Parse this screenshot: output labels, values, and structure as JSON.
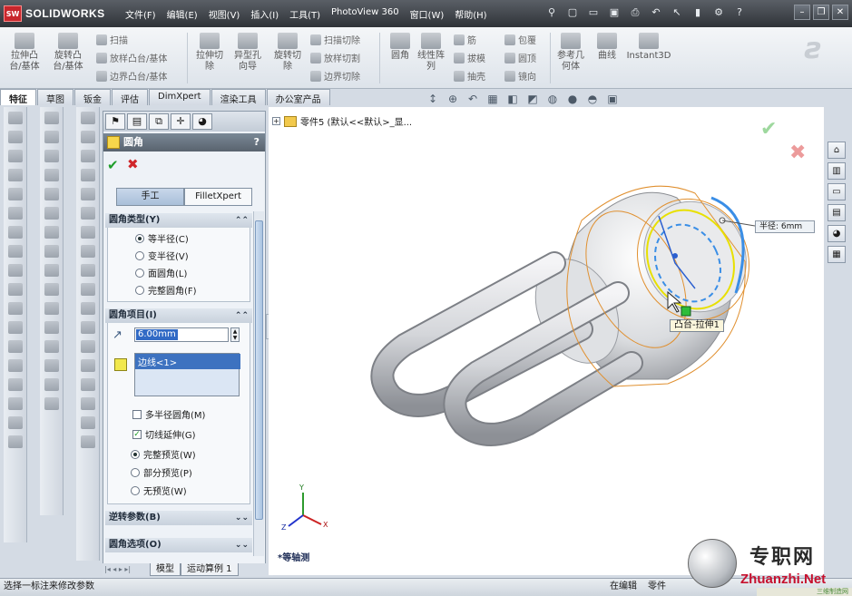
{
  "app": {
    "logo_badge": "SW",
    "name": "SOLIDWORKS"
  },
  "menu": [
    "文件(F)",
    "编辑(E)",
    "视图(V)",
    "插入(I)",
    "工具(T)",
    "PhotoView 360",
    "窗口(W)",
    "帮助(H)"
  ],
  "command_manager": {
    "big": [
      {
        "label": "拉伸凸\n台/基体",
        "icon": "extrude-boss-icon"
      },
      {
        "label": "旋转凸\n台/基体",
        "icon": "revolve-boss-icon"
      },
      {
        "label": "拉伸切\n除",
        "icon": "extrude-cut-icon"
      },
      {
        "label": "异型孔\n向导",
        "icon": "hole-wizard-icon"
      },
      {
        "label": "旋转切\n除",
        "icon": "revolve-cut-icon"
      },
      {
        "label": "圆角",
        "icon": "fillet-icon"
      },
      {
        "label": "线性阵\n列",
        "icon": "linear-pattern-icon"
      },
      {
        "label": "参考几\n何体",
        "icon": "ref-geometry-icon"
      },
      {
        "label": "曲线",
        "icon": "curves-icon"
      },
      {
        "label": "Instant3D",
        "icon": "instant3d-icon"
      }
    ],
    "small": [
      {
        "label": "扫描",
        "icon": "sweep-icon"
      },
      {
        "label": "放样凸台/基体",
        "icon": "loft-icon"
      },
      {
        "label": "边界凸台/基体",
        "icon": "boundary-boss-icon"
      },
      {
        "label": "扫描切除",
        "icon": "swept-cut-icon"
      },
      {
        "label": "放样切割",
        "icon": "lofted-cut-icon"
      },
      {
        "label": "边界切除",
        "icon": "boundary-cut-icon"
      },
      {
        "label": "筋",
        "icon": "rib-icon"
      },
      {
        "label": "拔模",
        "icon": "draft-icon"
      },
      {
        "label": "抽壳",
        "icon": "shell-icon"
      },
      {
        "label": "包覆",
        "icon": "wrap-icon"
      },
      {
        "label": "圆顶",
        "icon": "dome-icon"
      },
      {
        "label": "镜向",
        "icon": "mirror-icon"
      }
    ]
  },
  "tabs": [
    {
      "label": "特征",
      "active": true
    },
    {
      "label": "草图"
    },
    {
      "label": "钣金"
    },
    {
      "label": "评估"
    },
    {
      "label": "DimXpert"
    },
    {
      "label": "渲染工具"
    },
    {
      "label": "办公室产品"
    }
  ],
  "property_manager": {
    "title": "圆角",
    "help": "?",
    "ok": "✔",
    "cancel": "✖",
    "mode_tabs": {
      "manual": "手工",
      "filletxpert": "FilletXpert"
    },
    "fillet_type": {
      "heading": "圆角类型(Y)",
      "options": [
        "等半径(C)",
        "变半径(V)",
        "面圆角(L)",
        "完整圆角(F)"
      ],
      "selected": 0
    },
    "fillet_items": {
      "heading": "圆角项目(I)",
      "radius": "6.00mm",
      "edges": [
        "边线<1>"
      ],
      "multi_radius": "多半径圆角(M)",
      "tangent": "切线延伸(G)",
      "preview_options": [
        "完整预览(W)",
        "部分预览(P)",
        "无预览(W)"
      ],
      "preview_selected": 0
    },
    "setback": {
      "heading": "逆转参数(B)"
    },
    "fillet_options": {
      "heading": "圆角选项(O)"
    }
  },
  "model_tabs": [
    "模型",
    "运动算例 1"
  ],
  "tree_flyout": "零件5  (默认<<默认>_显...",
  "viewport": {
    "radius_callout": "半径:  6mm",
    "feature_tag": "凸台-拉伸1",
    "view_name": "*等轴测"
  },
  "status": {
    "left": "选择一标注来修改参数",
    "mode": "在编辑",
    "doc": "零件"
  },
  "watermark": {
    "title": "专职网",
    "url": "Zhuanzhi.Net",
    "bar": "三维制造网"
  },
  "colors": {
    "selection_yellow": "#e8e000",
    "preview_orange": "#e09030",
    "edge_blue": "#3a8ee6",
    "ok_green": "#1f9e2a",
    "cancel_red": "#d0262a"
  }
}
